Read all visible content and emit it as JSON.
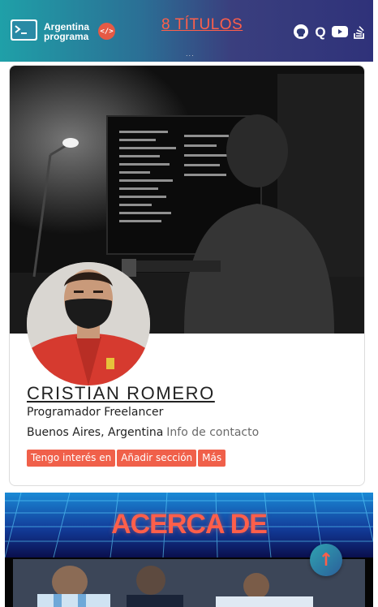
{
  "navbar": {
    "brand_line1": "Argentina",
    "brand_line2": "programa",
    "code_icon_text": "</>",
    "titles_link": "8 TÍTULOS",
    "dots": "...",
    "social": [
      "github-icon",
      "quora-icon",
      "youtube-icon",
      "stackoverflow-icon"
    ]
  },
  "profile": {
    "name": "CRISTIAN ROMERO",
    "role": "Programador Freelancer",
    "location": "Buenos Aires, Argentina",
    "contact_link": "Info de contacto",
    "buttons": [
      "Tengo interés en",
      "Añadir sección",
      "Más"
    ]
  },
  "about": {
    "title": "ACERCA DE"
  },
  "back_to_top": {
    "label": "↑"
  },
  "colors": {
    "accent": "#f0604a",
    "nav_start": "#1fa0a8",
    "nav_end": "#2f327a",
    "about_bg": "#0a0f4d"
  }
}
